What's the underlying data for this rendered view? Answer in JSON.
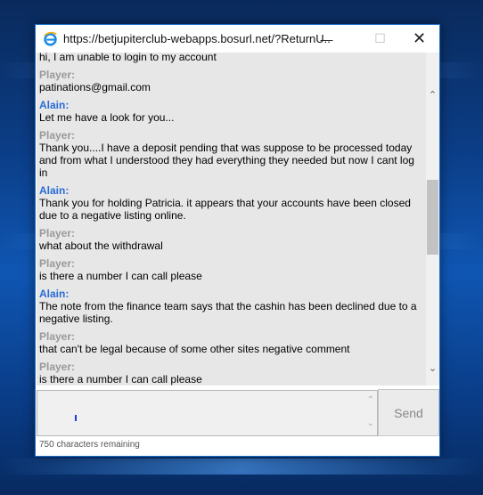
{
  "window": {
    "title": "https://betjupiterclub-webapps.bosurl.net/?ReturnU...",
    "icon": "internet-explorer-icon",
    "minimize_glyph": "—",
    "maximize_glyph": "☐",
    "close_glyph": "✕"
  },
  "chat": {
    "messages": [
      {
        "sender": "",
        "text": "hi, I am unable to login to my account",
        "type": "player"
      },
      {
        "sender": "Player:",
        "text": "patinations@gmail.com",
        "type": "player"
      },
      {
        "sender": "Alain:",
        "text": "Let me have a look for you...",
        "type": "agent"
      },
      {
        "sender": "Player:",
        "text": "Thank you....I have a deposit pending that was suppose to be processed today and from what I understood they had everything they needed  but now I cant log in",
        "type": "player"
      },
      {
        "sender": "Alain:",
        "text": "Thank you for holding Patricia. it appears that your accounts have been closed due to a negative listing online.",
        "type": "agent"
      },
      {
        "sender": "Player:",
        "text": "what about the withdrawal",
        "type": "player"
      },
      {
        "sender": "Player:",
        "text": "is there a number  I can call  please",
        "type": "player"
      },
      {
        "sender": "Alain:",
        "text": "The note from the finance team says that the cashin has been declined due to a negative listing.",
        "type": "agent"
      },
      {
        "sender": "Player:",
        "text": "that  can't be legal  because of some other sites negative comment",
        "type": "player"
      },
      {
        "sender": "Player:",
        "text": "is there a number I can call please",
        "type": "player"
      }
    ],
    "scroll_up_glyph": "⌃",
    "scroll_down_glyph": "⌄"
  },
  "composer": {
    "send_label": "Send",
    "remaining_text": "750 characters remaining"
  },
  "colors": {
    "agent_name": "#2a6bd6",
    "player_name": "#999999",
    "chat_bg": "#e7e7e7"
  }
}
